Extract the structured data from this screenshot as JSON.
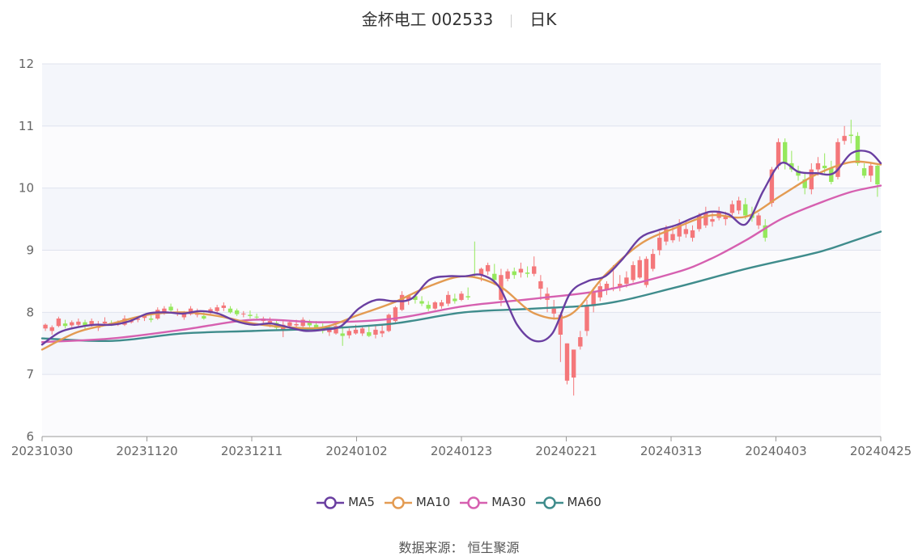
{
  "header": {
    "stock_name_code": "金杯电工 002533",
    "period": "日K"
  },
  "source": {
    "label": "数据来源：",
    "value": "恒生聚源"
  },
  "colors": {
    "up": "#f4777a",
    "down": "#95e85c",
    "plot_band": "#f4f6fb",
    "grid": "#dfe3ee",
    "MA5": "#6a3fa1",
    "MA10": "#e39b52",
    "MA30": "#d660b0",
    "MA60": "#3f8c8c"
  },
  "chart_data": {
    "type": "candlestick",
    "ylim": [
      6,
      12
    ],
    "y_ticks": [
      "6",
      "7",
      "8",
      "9",
      "10",
      "11",
      "12"
    ],
    "x_tick_labels": [
      "20231030",
      "20231120",
      "20231211",
      "20240102",
      "20240123",
      "20240221",
      "20240313",
      "20240403",
      "20240425"
    ],
    "x_range": [
      0,
      120
    ],
    "legend": [
      "MA5",
      "MA10",
      "MA30",
      "MA60"
    ],
    "legend_position": "bottom",
    "candles_ohlc": [
      [
        7.74,
        7.82,
        7.7,
        7.8
      ],
      [
        7.7,
        7.79,
        7.64,
        7.76
      ],
      [
        7.78,
        7.93,
        7.76,
        7.9
      ],
      [
        7.82,
        7.88,
        7.74,
        7.78
      ],
      [
        7.79,
        7.87,
        7.76,
        7.84
      ],
      [
        7.8,
        7.9,
        7.76,
        7.85
      ],
      [
        7.84,
        7.88,
        7.72,
        7.77
      ],
      [
        7.8,
        7.9,
        7.77,
        7.86
      ],
      [
        7.75,
        7.86,
        7.7,
        7.78
      ],
      [
        7.82,
        7.92,
        7.8,
        7.85
      ],
      [
        7.83,
        7.87,
        7.78,
        7.8
      ],
      [
        7.8,
        7.87,
        7.78,
        7.83
      ],
      [
        7.8,
        7.95,
        7.78,
        7.9
      ],
      [
        7.84,
        7.91,
        7.82,
        7.86
      ],
      [
        7.88,
        7.94,
        7.84,
        7.9
      ],
      [
        7.91,
        7.96,
        7.86,
        7.94
      ],
      [
        7.9,
        7.95,
        7.84,
        7.88
      ],
      [
        7.9,
        8.08,
        7.88,
        8.04
      ],
      [
        7.98,
        8.1,
        7.96,
        8.06
      ],
      [
        8.09,
        8.14,
        8.0,
        8.03
      ],
      [
        7.98,
        8.06,
        7.94,
        7.99
      ],
      [
        7.92,
        8.02,
        7.88,
        7.99
      ],
      [
        7.97,
        8.1,
        7.95,
        8.06
      ],
      [
        7.96,
        8.06,
        7.92,
        7.98
      ],
      [
        7.94,
        8.0,
        7.88,
        7.9
      ],
      [
        7.99,
        8.08,
        7.96,
        8.05
      ],
      [
        8.02,
        8.12,
        7.98,
        8.08
      ],
      [
        8.07,
        8.16,
        8.02,
        8.11
      ],
      [
        8.06,
        8.1,
        7.98,
        8.0
      ],
      [
        8.03,
        8.06,
        7.94,
        7.97
      ],
      [
        7.97,
        8.02,
        7.92,
        7.98
      ],
      [
        7.96,
        8.03,
        7.9,
        7.94
      ],
      [
        7.93,
        7.98,
        7.88,
        7.92
      ],
      [
        7.86,
        7.93,
        7.8,
        7.9
      ],
      [
        7.82,
        7.92,
        7.76,
        7.86
      ],
      [
        7.83,
        7.86,
        7.7,
        7.75
      ],
      [
        7.72,
        7.86,
        7.6,
        7.8
      ],
      [
        7.78,
        7.86,
        7.74,
        7.84
      ],
      [
        7.79,
        7.88,
        7.74,
        7.81
      ],
      [
        7.78,
        7.92,
        7.76,
        7.88
      ],
      [
        7.84,
        7.88,
        7.76,
        7.79
      ],
      [
        7.8,
        7.86,
        7.72,
        7.75
      ],
      [
        7.74,
        7.82,
        7.66,
        7.7
      ],
      [
        7.68,
        7.8,
        7.62,
        7.72
      ],
      [
        7.66,
        7.82,
        7.64,
        7.78
      ],
      [
        7.66,
        7.76,
        7.46,
        7.62
      ],
      [
        7.63,
        7.74,
        7.58,
        7.7
      ],
      [
        7.66,
        7.8,
        7.64,
        7.72
      ],
      [
        7.66,
        7.78,
        7.62,
        7.74
      ],
      [
        7.68,
        7.8,
        7.6,
        7.62
      ],
      [
        7.64,
        7.78,
        7.58,
        7.72
      ],
      [
        7.66,
        7.8,
        7.6,
        7.7
      ],
      [
        7.7,
        7.98,
        7.68,
        7.96
      ],
      [
        7.86,
        8.1,
        7.84,
        8.08
      ],
      [
        8.04,
        8.34,
        8.02,
        8.28
      ],
      [
        8.2,
        8.28,
        8.12,
        8.26
      ],
      [
        8.26,
        8.3,
        8.14,
        8.2
      ],
      [
        8.18,
        8.26,
        8.1,
        8.14
      ],
      [
        8.12,
        8.18,
        8.02,
        8.06
      ],
      [
        8.06,
        8.18,
        8.04,
        8.16
      ],
      [
        8.1,
        8.2,
        8.06,
        8.16
      ],
      [
        8.14,
        8.34,
        8.1,
        8.28
      ],
      [
        8.22,
        8.3,
        8.14,
        8.18
      ],
      [
        8.2,
        8.34,
        8.18,
        8.3
      ],
      [
        8.26,
        8.4,
        8.2,
        8.24
      ],
      [
        8.62,
        9.14,
        8.58,
        8.6
      ],
      [
        8.6,
        8.72,
        8.5,
        8.7
      ],
      [
        8.66,
        8.8,
        8.6,
        8.76
      ],
      [
        8.62,
        8.78,
        8.44,
        8.52
      ],
      [
        8.2,
        8.7,
        8.1,
        8.6
      ],
      [
        8.54,
        8.7,
        8.5,
        8.66
      ],
      [
        8.66,
        8.72,
        8.54,
        8.6
      ],
      [
        8.64,
        8.8,
        8.56,
        8.7
      ],
      [
        8.64,
        8.74,
        8.56,
        8.62
      ],
      [
        8.62,
        8.9,
        8.58,
        8.74
      ],
      [
        8.38,
        8.6,
        8.2,
        8.5
      ],
      [
        8.2,
        8.4,
        8.0,
        8.3
      ],
      [
        7.98,
        8.2,
        7.88,
        8.06
      ],
      [
        7.64,
        8.0,
        7.2,
        7.96
      ],
      [
        6.9,
        7.5,
        6.84,
        7.5
      ],
      [
        6.95,
        7.4,
        6.66,
        7.4
      ],
      [
        7.45,
        7.7,
        7.4,
        7.6
      ],
      [
        7.7,
        8.2,
        7.62,
        8.1
      ],
      [
        8.1,
        8.4,
        8.0,
        8.34
      ],
      [
        8.24,
        8.48,
        8.18,
        8.42
      ],
      [
        8.36,
        8.5,
        8.28,
        8.46
      ],
      [
        8.38,
        8.76,
        8.34,
        8.4
      ],
      [
        8.4,
        8.6,
        8.34,
        8.46
      ],
      [
        8.46,
        8.66,
        8.4,
        8.56
      ],
      [
        8.52,
        8.82,
        8.48,
        8.76
      ],
      [
        8.56,
        8.9,
        8.54,
        8.84
      ],
      [
        8.44,
        8.9,
        8.4,
        8.86
      ],
      [
        8.7,
        9.02,
        8.66,
        8.94
      ],
      [
        9.0,
        9.3,
        8.92,
        9.2
      ],
      [
        9.14,
        9.4,
        9.08,
        9.34
      ],
      [
        9.16,
        9.4,
        9.12,
        9.26
      ],
      [
        9.22,
        9.5,
        9.14,
        9.42
      ],
      [
        9.26,
        9.48,
        9.2,
        9.34
      ],
      [
        9.2,
        9.4,
        9.14,
        9.32
      ],
      [
        9.34,
        9.6,
        9.3,
        9.56
      ],
      [
        9.4,
        9.7,
        9.36,
        9.6
      ],
      [
        9.46,
        9.6,
        9.38,
        9.5
      ],
      [
        9.52,
        9.7,
        9.48,
        9.62
      ],
      [
        9.5,
        9.62,
        9.4,
        9.56
      ],
      [
        9.6,
        9.8,
        9.56,
        9.74
      ],
      [
        9.64,
        9.86,
        9.58,
        9.8
      ],
      [
        9.74,
        9.84,
        9.5,
        9.56
      ],
      [
        9.58,
        9.7,
        9.46,
        9.52
      ],
      [
        9.4,
        9.6,
        9.34,
        9.56
      ],
      [
        9.4,
        9.5,
        9.14,
        9.2
      ],
      [
        9.76,
        10.34,
        9.7,
        10.3
      ],
      [
        10.36,
        10.8,
        10.3,
        10.74
      ],
      [
        10.74,
        10.8,
        10.3,
        10.4
      ],
      [
        10.4,
        10.6,
        10.26,
        10.3
      ],
      [
        10.28,
        10.36,
        10.12,
        10.2
      ],
      [
        10.14,
        10.24,
        9.9,
        10.0
      ],
      [
        9.98,
        10.4,
        9.9,
        10.3
      ],
      [
        10.3,
        10.5,
        10.2,
        10.4
      ],
      [
        10.36,
        10.56,
        10.24,
        10.32
      ],
      [
        10.32,
        10.44,
        10.06,
        10.1
      ],
      [
        10.18,
        10.8,
        10.14,
        10.74
      ],
      [
        10.76,
        11.0,
        10.7,
        10.84
      ],
      [
        10.86,
        11.1,
        10.72,
        10.84
      ],
      [
        10.84,
        10.9,
        10.36,
        10.4
      ],
      [
        10.32,
        10.4,
        10.16,
        10.2
      ],
      [
        10.2,
        10.42,
        10.1,
        10.36
      ],
      [
        10.36,
        10.4,
        9.86,
        10.06
      ]
    ],
    "series": [
      {
        "name": "MA5",
        "values": [
          [
            0,
            7.48
          ],
          [
            3,
            7.68
          ],
          [
            6,
            7.76
          ],
          [
            9,
            7.8
          ],
          [
            12,
            7.8
          ],
          [
            15,
            7.86
          ],
          [
            18,
            7.98
          ],
          [
            21,
            8.0
          ],
          [
            24,
            7.98
          ],
          [
            27,
            8.02
          ],
          [
            30,
            7.98
          ],
          [
            33,
            7.86
          ],
          [
            36,
            7.8
          ],
          [
            39,
            7.82
          ],
          [
            42,
            7.76
          ],
          [
            45,
            7.7
          ],
          [
            48,
            7.72
          ],
          [
            51,
            7.78
          ],
          [
            54,
            8.06
          ],
          [
            57,
            8.2
          ],
          [
            60,
            8.18
          ],
          [
            63,
            8.22
          ],
          [
            66,
            8.52
          ],
          [
            69,
            8.58
          ],
          [
            72,
            8.58
          ],
          [
            75,
            8.6
          ],
          [
            78,
            8.4
          ],
          [
            81,
            7.8
          ],
          [
            84,
            7.54
          ],
          [
            87,
            7.66
          ],
          [
            90,
            8.3
          ],
          [
            93,
            8.5
          ],
          [
            96,
            8.58
          ],
          [
            99,
            8.86
          ],
          [
            102,
            9.2
          ],
          [
            105,
            9.32
          ],
          [
            108,
            9.4
          ],
          [
            111,
            9.52
          ],
          [
            114,
            9.62
          ],
          [
            117,
            9.58
          ],
          [
            120,
            9.42
          ],
          [
            123,
            9.96
          ],
          [
            126,
            10.4
          ],
          [
            129,
            10.26
          ],
          [
            132,
            10.24
          ],
          [
            135,
            10.24
          ],
          [
            138,
            10.56
          ],
          [
            141,
            10.58
          ],
          [
            143,
            10.4
          ]
        ]
      },
      {
        "name": "MA10",
        "values": [
          [
            0,
            7.4
          ],
          [
            6,
            7.68
          ],
          [
            12,
            7.82
          ],
          [
            18,
            7.96
          ],
          [
            24,
            8.0
          ],
          [
            30,
            7.94
          ],
          [
            36,
            7.82
          ],
          [
            42,
            7.76
          ],
          [
            48,
            7.76
          ],
          [
            54,
            7.96
          ],
          [
            60,
            8.16
          ],
          [
            66,
            8.42
          ],
          [
            72,
            8.58
          ],
          [
            78,
            8.42
          ],
          [
            84,
            7.98
          ],
          [
            90,
            7.96
          ],
          [
            96,
            8.6
          ],
          [
            102,
            9.1
          ],
          [
            108,
            9.36
          ],
          [
            114,
            9.56
          ],
          [
            120,
            9.54
          ],
          [
            126,
            9.88
          ],
          [
            132,
            10.22
          ],
          [
            138,
            10.42
          ],
          [
            143,
            10.38
          ]
        ]
      },
      {
        "name": "MA30",
        "values": [
          [
            0,
            7.52
          ],
          [
            12,
            7.58
          ],
          [
            24,
            7.72
          ],
          [
            36,
            7.88
          ],
          [
            48,
            7.84
          ],
          [
            60,
            7.9
          ],
          [
            72,
            8.1
          ],
          [
            84,
            8.22
          ],
          [
            96,
            8.36
          ],
          [
            108,
            8.64
          ],
          [
            114,
            8.86
          ],
          [
            120,
            9.16
          ],
          [
            126,
            9.5
          ],
          [
            132,
            9.74
          ],
          [
            138,
            9.94
          ],
          [
            143,
            10.04
          ]
        ]
      },
      {
        "name": "MA60",
        "values": [
          [
            0,
            7.58
          ],
          [
            12,
            7.54
          ],
          [
            24,
            7.66
          ],
          [
            36,
            7.7
          ],
          [
            48,
            7.74
          ],
          [
            60,
            7.82
          ],
          [
            72,
            8.0
          ],
          [
            84,
            8.06
          ],
          [
            96,
            8.14
          ],
          [
            108,
            8.4
          ],
          [
            120,
            8.7
          ],
          [
            132,
            8.96
          ],
          [
            138,
            9.14
          ],
          [
            143,
            9.3
          ]
        ]
      }
    ]
  }
}
